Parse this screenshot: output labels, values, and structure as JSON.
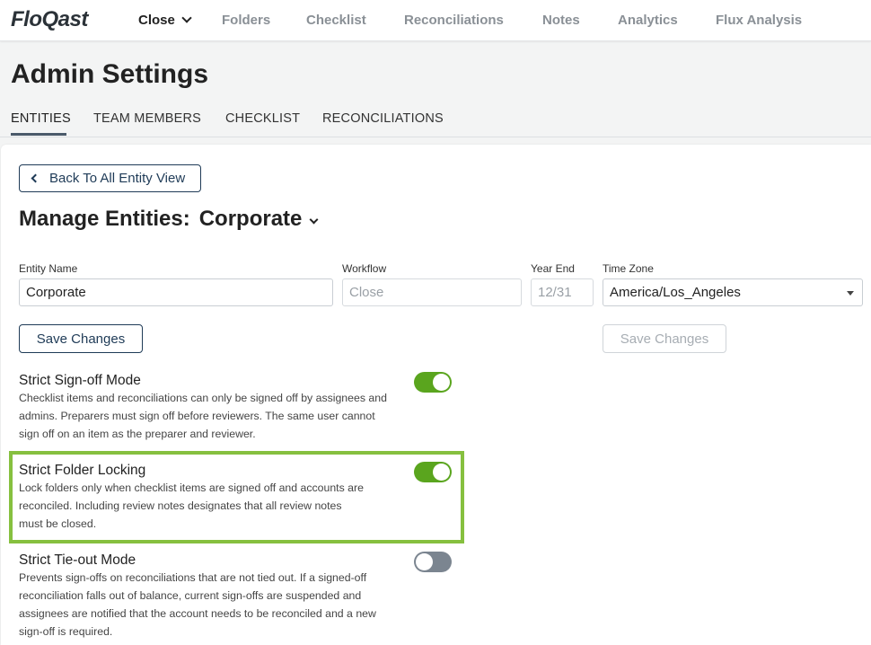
{
  "app": {
    "logo": "FloQast"
  },
  "nav": {
    "close": "Close",
    "folders": "Folders",
    "checklist": "Checklist",
    "reconciliations": "Reconciliations",
    "notes": "Notes",
    "analytics": "Analytics",
    "flux": "Flux Analysis"
  },
  "page": {
    "title": "Admin Settings"
  },
  "tabs": {
    "entities": "ENTITIES",
    "team": "TEAM MEMBERS",
    "checklist": "CHECKLIST",
    "reconciliations": "RECONCILIATIONS"
  },
  "card": {
    "back": "Back To All Entity View",
    "manage_label": "Manage Entities:",
    "entity": "Corporate"
  },
  "fields": {
    "entity_name": {
      "label": "Entity Name",
      "value": "Corporate"
    },
    "workflow": {
      "label": "Workflow",
      "value": "Close"
    },
    "year_end": {
      "label": "Year End",
      "value": "12/31"
    },
    "time_zone": {
      "label": "Time Zone",
      "value": "America/Los_Angeles"
    }
  },
  "buttons": {
    "save": "Save Changes",
    "save_disabled": "Save Changes"
  },
  "settings": [
    {
      "title": "Strict Sign-off Mode",
      "line1": "Checklist items and reconciliations can only be signed off by assignees and",
      "line2": "admins. Preparers must sign off before reviewers. The same user cannot",
      "line3": "sign off on an item as the preparer and reviewer.",
      "enabled": true
    },
    {
      "title": "Strict Folder Locking",
      "line1": "Lock folders only when checklist items are signed off and accounts are",
      "line2": "reconciled. Including review notes designates that all review notes",
      "line3": "must be closed.",
      "enabled": true
    },
    {
      "title": "Strict Tie-out Mode",
      "line1": "Prevents sign-offs on reconciliations that are not tied out. If a signed-off",
      "line2": "reconciliation falls out of balance, current sign-offs are suspended and",
      "line3": "assignees are notified that the account needs to be reconciled and a new",
      "line4": "sign-off is required.",
      "enabled": false
    }
  ],
  "colors": {
    "accent": "#5aa51e",
    "highlight": "#86c03f",
    "navy": "#1f3b57"
  }
}
